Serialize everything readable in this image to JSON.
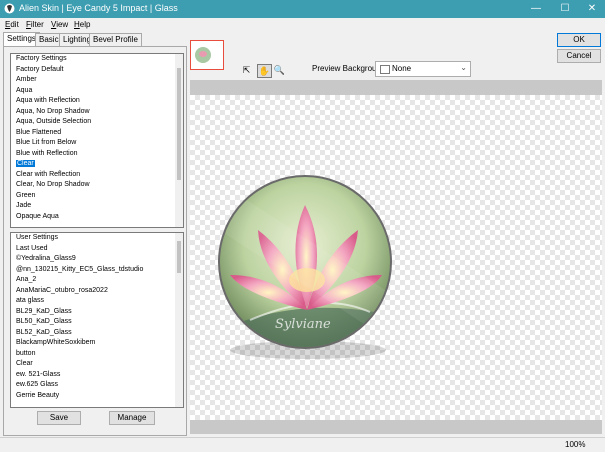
{
  "window": {
    "title": "Alien Skin | Eye Candy 5 Impact | Glass"
  },
  "menu": [
    {
      "key": "E",
      "rest": "dit"
    },
    {
      "key": "F",
      "rest": "ilter"
    },
    {
      "key": "V",
      "rest": "iew"
    },
    {
      "key": "H",
      "rest": "elp"
    }
  ],
  "tabs": [
    "Settings",
    "Basic",
    "Lighting",
    "Bevel Profile"
  ],
  "factory": {
    "items": [
      "Factory Settings",
      "Factory Default",
      "Amber",
      "Aqua",
      "Aqua with Reflection",
      "Aqua, No Drop Shadow",
      "Aqua, Outside Selection",
      "Blue Flattened",
      "Blue Lit from Below",
      "Blue with Reflection",
      "Clear",
      "Clear with Reflection",
      "Clear, No Drop Shadow",
      "Green",
      "Jade",
      "Opaque Aqua"
    ],
    "selected": "Clear"
  },
  "user": {
    "items": [
      "User Settings",
      "Last Used",
      "©Yedralina_Glass9",
      "@nn_130215_Kitty_EC5_Glass_tdstudio",
      "Ana_2",
      "AnaMariaC_otubro_rosa2022",
      "ata glass",
      "BL29_KaD_Glass",
      "BL50_KaD_Glass",
      "BL52_KaD_Glass",
      "BlackampWhiteSoxkibem",
      "button",
      "Clear",
      "ew. 521-Glass",
      "ew.625 Glass",
      "Gerrie Beauty"
    ]
  },
  "buttons": {
    "save": "Save",
    "manage": "Manage",
    "ok": "OK",
    "cancel": "Cancel"
  },
  "preview": {
    "label": "Preview Background:",
    "value": "None"
  },
  "status": {
    "zoom": "100%"
  },
  "watermark": "Sylviane",
  "colors": {
    "titlebar": "#3d9db1",
    "selection": "#0078d7"
  }
}
